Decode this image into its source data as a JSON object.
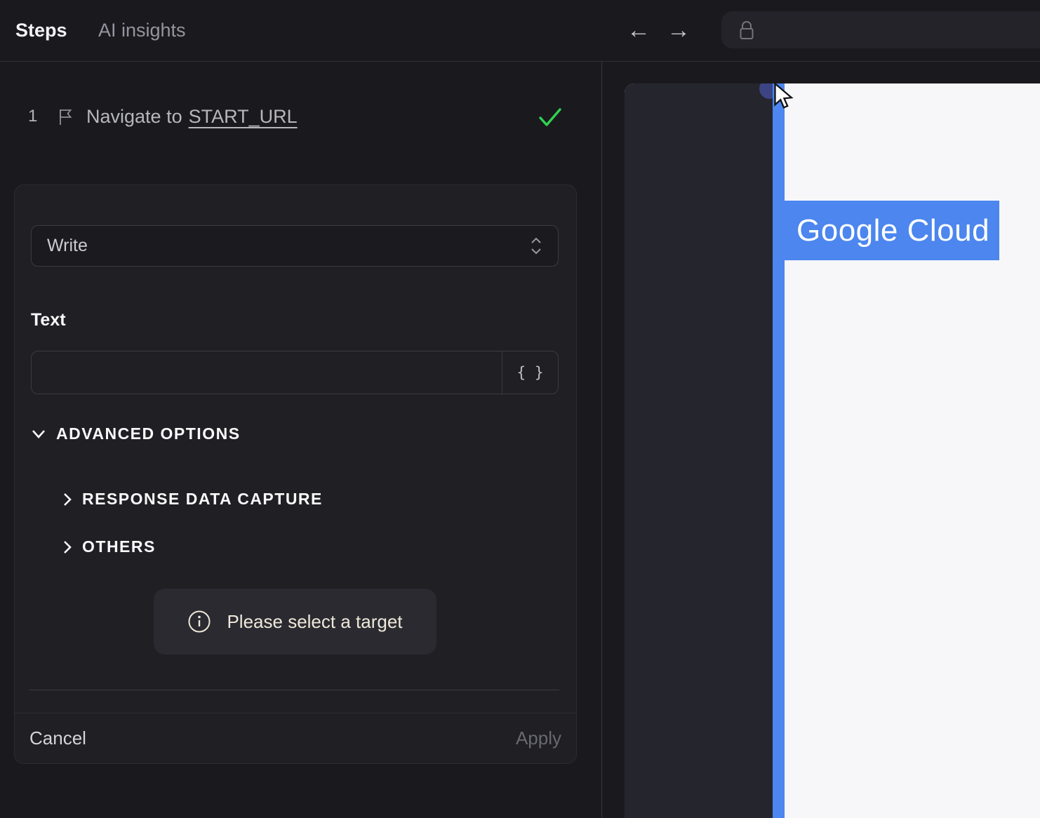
{
  "left_panel": {
    "tabs": [
      {
        "label": "Steps",
        "active": true
      },
      {
        "label": "AI insights",
        "active": false
      }
    ],
    "step": {
      "number": "1",
      "action": "Navigate to",
      "target": "START_URL",
      "status": "completed"
    },
    "editor": {
      "action_dropdown": {
        "value": "Write"
      },
      "text_label": "Text",
      "text_input": {
        "value": "",
        "placeholder": ""
      },
      "braces_label": "{ }",
      "advanced_label": "ADVANCED OPTIONS",
      "sections": [
        {
          "label": "RESPONSE DATA CAPTURE"
        },
        {
          "label": "OTHERS"
        }
      ],
      "hint": "Please select a target",
      "cancel_label": "Cancel",
      "apply_label": "Apply"
    }
  },
  "browser": {
    "icons": {
      "back": "←",
      "forward": "→"
    },
    "page": {
      "brand": "Google Cloud"
    }
  },
  "colors": {
    "accent_blue": "#4c86ee",
    "success_green": "#2fd34f",
    "hint_cream": "#efe8da",
    "panel_bg": "#1a1a1e",
    "card_bg": "#1f1f24",
    "preview_sidebar": "#25252d"
  }
}
